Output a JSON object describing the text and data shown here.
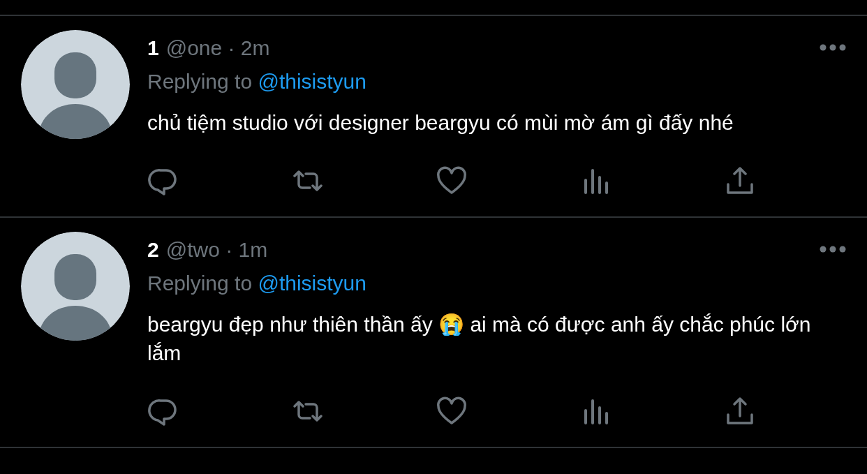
{
  "tweets": [
    {
      "name": "1",
      "meta": "@one · 2m",
      "replying_label": "Replying to",
      "replying_handle": "@thisistyun",
      "text": "chủ tiệm studio với designer beargyu có mùi mờ ám gì đấy nhé"
    },
    {
      "name": "2",
      "meta": "@two · 1m",
      "replying_label": "Replying to",
      "replying_handle": "@thisistyun",
      "text": "beargyu đẹp như thiên thần ấy 😭 ai mà có được anh ấy chắc phúc lớn lắm"
    }
  ]
}
